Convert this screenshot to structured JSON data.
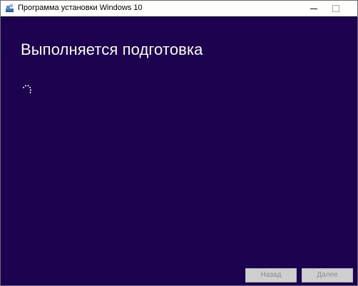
{
  "window": {
    "title": "Программа установки Windows 10"
  },
  "main": {
    "heading": "Выполняется подготовка"
  },
  "footer": {
    "back_label": "Назад",
    "next_label": "Далее"
  },
  "icons": {
    "app": "windows-setup-icon",
    "spinner": "loading-spinner-icon"
  },
  "colors": {
    "background": "#1d0250",
    "text": "#ffffff",
    "button_disabled": "#cfcfcf",
    "button_text_disabled": "#8a8a8a"
  }
}
